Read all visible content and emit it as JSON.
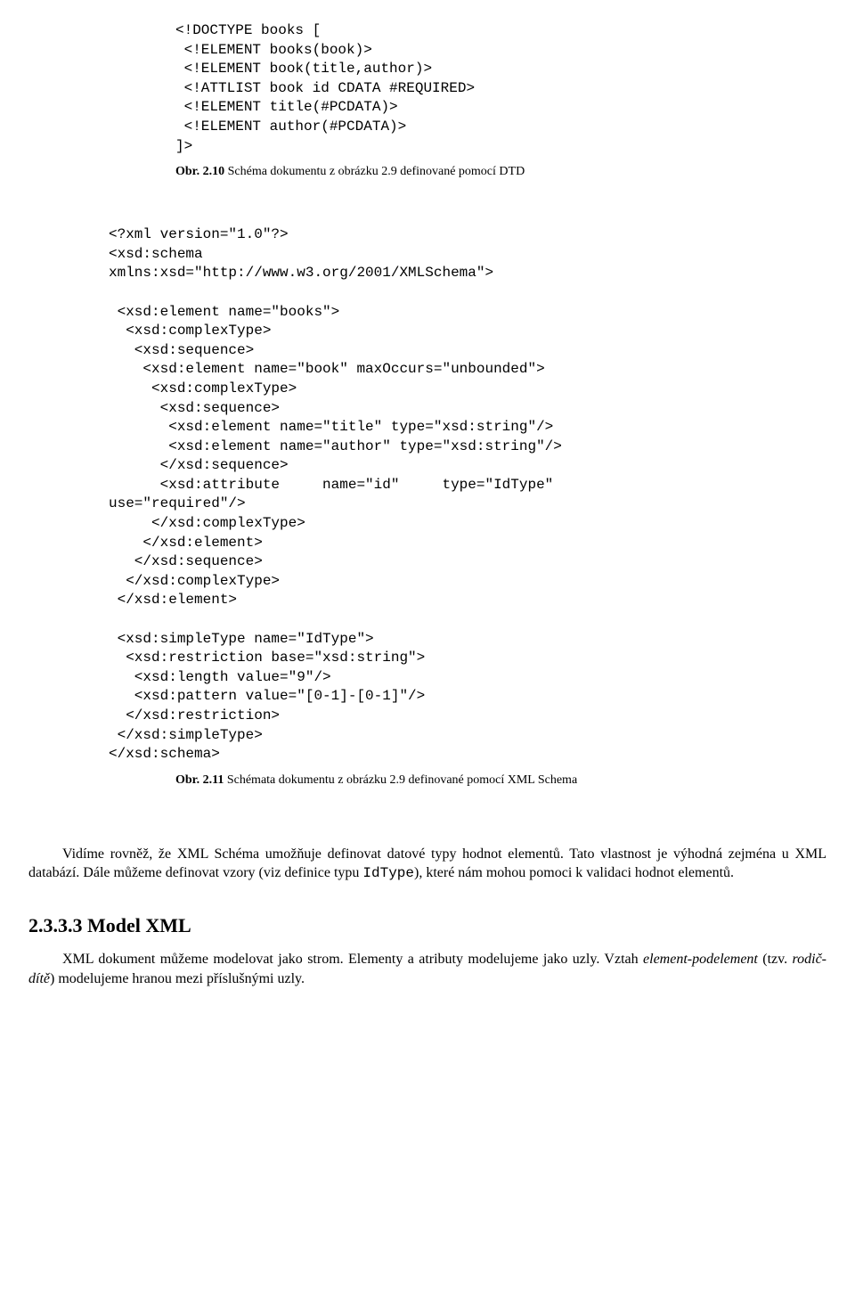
{
  "dtd_block": "<!DOCTYPE books [\n <!ELEMENT books(book)>\n <!ELEMENT book(title,author)>\n <!ATTLIST book id CDATA #REQUIRED>\n <!ELEMENT title(#PCDATA)>\n <!ELEMENT author(#PCDATA)>\n]>",
  "caption1_bold": "Obr. 2.10",
  "caption1_rest": " Schéma dokumentu z obrázku 2.9 definované pomocí DTD",
  "xsd_block": "<?xml version=\"1.0\"?>\n<xsd:schema\nxmlns:xsd=\"http://www.w3.org/2001/XMLSchema\">\n\n <xsd:element name=\"books\">\n  <xsd:complexType>\n   <xsd:sequence>\n    <xsd:element name=\"book\" maxOccurs=\"unbounded\">\n     <xsd:complexType>\n      <xsd:sequence>\n       <xsd:element name=\"title\" type=\"xsd:string\"/>\n       <xsd:element name=\"author\" type=\"xsd:string\"/>\n      </xsd:sequence>\n      <xsd:attribute     name=\"id\"     type=\"IdType\"\nuse=\"required\"/>\n     </xsd:complexType>\n    </xsd:element>\n   </xsd:sequence>\n  </xsd:complexType>\n </xsd:element>\n\n <xsd:simpleType name=\"IdType\">\n  <xsd:restriction base=\"xsd:string\">\n   <xsd:length value=\"9\"/>\n   <xsd:pattern value=\"[0-1]-[0-1]\"/>\n  </xsd:restriction>\n </xsd:simpleType>\n</xsd:schema>",
  "caption2_bold": "Obr. 2.11",
  "caption2_rest": " Schémata dokumentu z obrázku 2.9 definované pomocí XML Schema",
  "para1_a": "Vidíme rovněž, že XML Schéma umožňuje definovat datové typy hodnot elementů. Tato vlastnost je výhodná zejména u XML databází. Dále můžeme definovat vzory  (viz definice typu ",
  "para1_code": "IdType",
  "para1_b": "), které nám mohou pomoci k validaci hodnot elementů.",
  "heading": "2.3.3.3 Model XML",
  "para2_a": "XML dokument můžeme modelovat jako strom. Elementy a atributy modelujeme jako uzly. Vztah ",
  "para2_i1": "element-podelement",
  "para2_b": " (tzv. ",
  "para2_i2": "rodič-dítě",
  "para2_c": ") modelujeme hranou mezi příslušnými uzly."
}
